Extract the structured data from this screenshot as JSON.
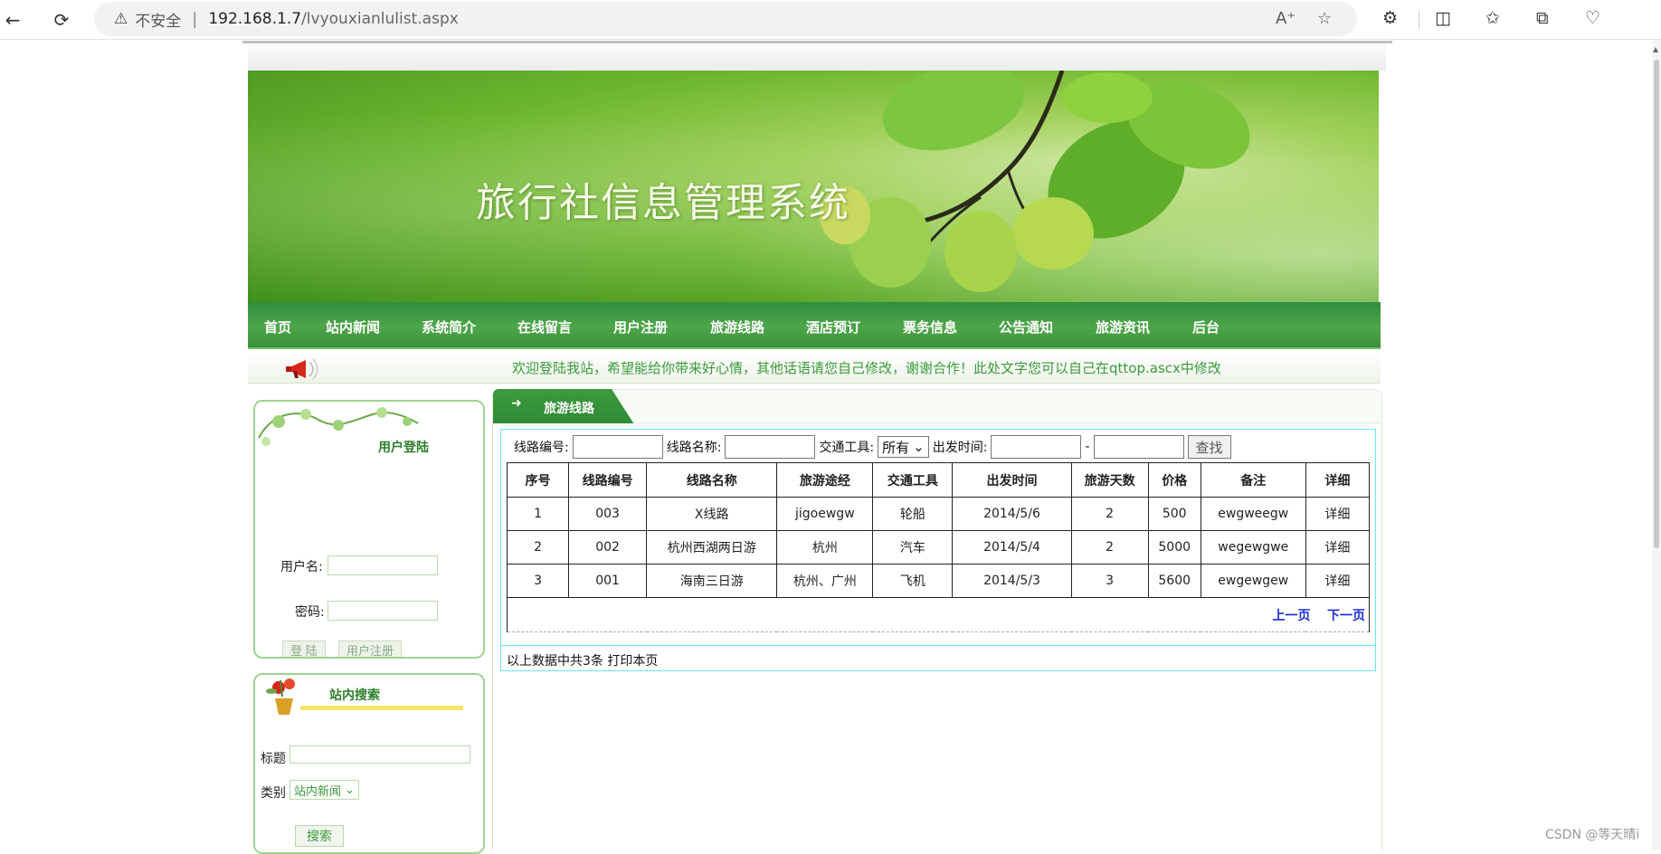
{
  "browser": {
    "security_label": "不安全",
    "url_host": "192.168.1.7",
    "url_path": "/lvyouxianlulist.aspx"
  },
  "site": {
    "title": "旅行社信息管理系统",
    "nav": [
      "首页",
      "站内新闻",
      "系统简介",
      "在线留言",
      "用户注册",
      "旅游线路",
      "酒店预订",
      "票务信息",
      "公告通知",
      "旅游资讯",
      "后台"
    ],
    "notice": "欢迎登陆我站，希望能给你带来好心情，其他话语请您自己修改，谢谢合作！此处文字您可以自己在qttop.ascx中修改"
  },
  "login": {
    "title": "用户登陆",
    "username_label": "用户名:",
    "password_label": "密码:",
    "login_button": "登 陆",
    "register_button": "用户注册"
  },
  "site_search": {
    "title": "站内搜索",
    "title_label": "标题",
    "category_label": "类别",
    "category_value": "站内新闻",
    "search_button": "搜索"
  },
  "main": {
    "tab_label": "旅游线路",
    "filters": {
      "route_no_label": "线路编号:",
      "route_name_label": "线路名称:",
      "transport_label": "交通工具:",
      "transport_value": "所有",
      "depart_label": "出发时间:",
      "range_sep": "-",
      "find_button": "查找"
    },
    "table": {
      "headers": [
        "序号",
        "线路编号",
        "线路名称",
        "旅游途经",
        "交通工具",
        "出发时间",
        "旅游天数",
        "价格",
        "备注",
        "详细"
      ],
      "rows": [
        [
          "1",
          "003",
          "X线路",
          "jigoewgw",
          "轮船",
          "2014/5/6",
          "2",
          "500",
          "ewgweegw",
          "详细"
        ],
        [
          "2",
          "002",
          "杭州西湖两日游",
          "杭州",
          "汽车",
          "2014/5/4",
          "2",
          "5000",
          "wegewgwe",
          "详细"
        ],
        [
          "3",
          "001",
          "海南三日游",
          "杭州、广州",
          "飞机",
          "2014/5/3",
          "3",
          "5600",
          "ewgewgew",
          "详细"
        ]
      ],
      "prev_page": "上一页",
      "next_page": "下一页"
    },
    "summary": "以上数据中共3条  打印本页"
  },
  "watermark": "CSDN @等天晴i"
}
